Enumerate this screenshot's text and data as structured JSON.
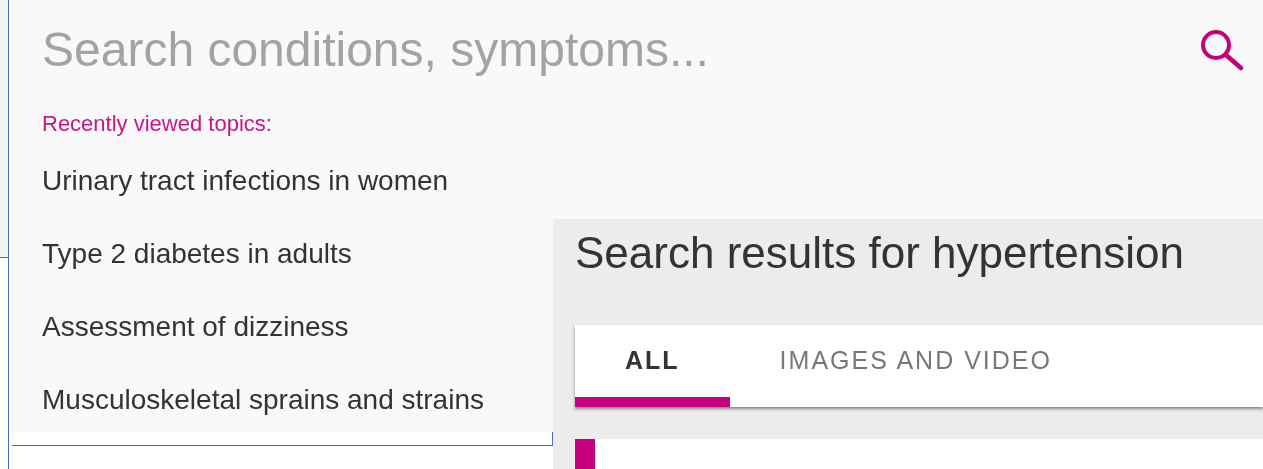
{
  "search": {
    "placeholder": "Search conditions, symptoms..."
  },
  "recent": {
    "label": "Recently viewed topics:",
    "items": [
      "Urinary tract infections in women",
      "Type 2 diabetes in adults",
      "Assessment of dizziness",
      "Musculoskeletal sprains and strains"
    ]
  },
  "results": {
    "heading": "Search results for hypertension",
    "tabs": [
      {
        "label": "ALL",
        "selected": true
      },
      {
        "label": "IMAGES AND VIDEO",
        "selected": false
      }
    ]
  }
}
